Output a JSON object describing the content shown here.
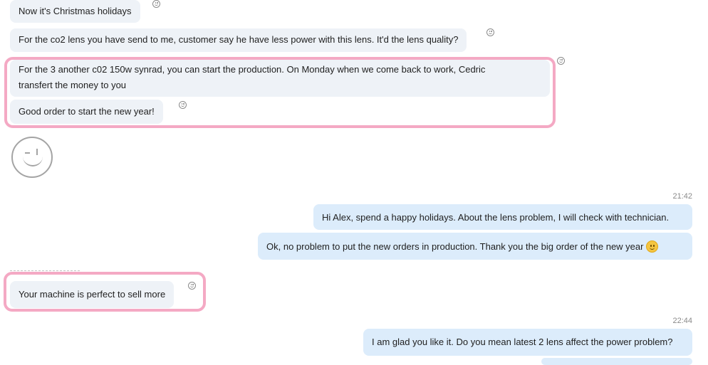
{
  "messages": [
    {
      "text": "Now it's Christmas holidays"
    },
    {
      "text": "For the co2 lens you have send to me, customer say he have less power with this lens. It'd the lens quality?"
    },
    {
      "line1": "For the 3 another c02 150w synrad,  you can start the production. On Monday when we come back to work, Cedric",
      "line2": "transfert the money to you"
    },
    {
      "text": "Good order to start the new year!"
    },
    {
      "time": "21:42"
    },
    {
      "text": "Hi Alex, spend a happy holidays. About the lens problem, I will check with technician."
    },
    {
      "text": "Ok, no problem to put the new orders in production. Thank you the big order of the new year",
      "emoji": "smiling-face-emoji"
    },
    {
      "text": "Your machine is perfect to sell more"
    },
    {
      "time": "22:44"
    },
    {
      "text": "I am glad you like it. Do you mean latest 2 lens affect the power problem?"
    }
  ],
  "icons": {
    "reaction": "smiley-outline-icon",
    "sticker": "winking-face-sticker"
  },
  "colors": {
    "incoming_bubble": "#eef2f7",
    "outgoing_bubble": "#dcecfb",
    "highlight": "#f4a9c4",
    "timestamp": "#8a8a8a"
  }
}
